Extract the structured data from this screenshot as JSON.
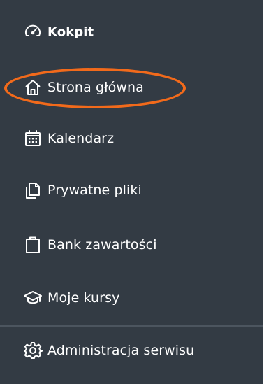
{
  "nav": {
    "items": [
      {
        "label": "Kokpit",
        "icon": "gauge-icon"
      },
      {
        "label": "Strona główna",
        "icon": "home-icon"
      },
      {
        "label": "Kalendarz",
        "icon": "calendar-icon"
      },
      {
        "label": "Prywatne pliki",
        "icon": "files-icon"
      },
      {
        "label": "Bank zawartości",
        "icon": "clipboard-icon"
      },
      {
        "label": "Moje kursy",
        "icon": "graduation-cap-icon"
      },
      {
        "label": "Administracja serwisu",
        "icon": "gear-icon"
      }
    ]
  },
  "colors": {
    "sidebar_background": "#333b44",
    "text": "#ffffff",
    "highlight": "#f26a1b",
    "divider": "#4c555f"
  }
}
